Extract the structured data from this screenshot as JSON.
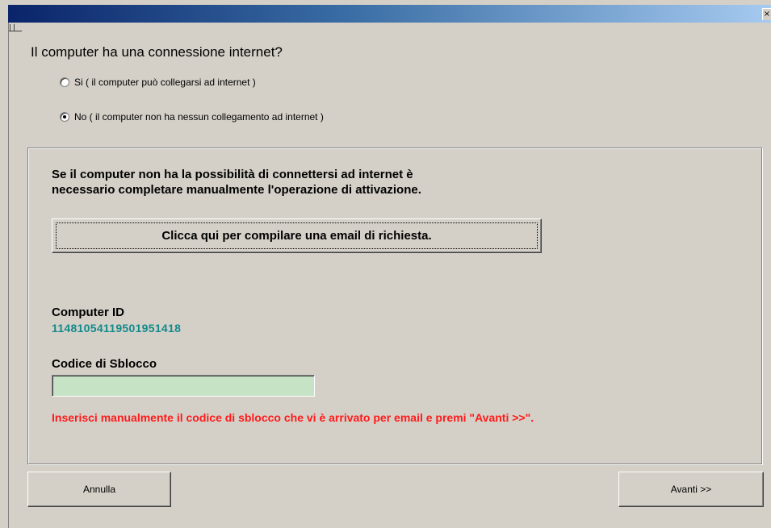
{
  "titlebar": {
    "close_label": "×"
  },
  "question": "Il computer ha una connessione internet?",
  "options": [
    {
      "label": "Si ( il computer può collegarsi ad internet )",
      "checked": false
    },
    {
      "label": "No ( il computer non ha nessun collegamento ad internet )",
      "checked": true
    }
  ],
  "panel": {
    "info_line1": "Se il computer non ha la possibilità di connettersi ad internet è",
    "info_line2": "necessario completare manualmente l'operazione di attivazione.",
    "email_button": "Clicca qui per compilare una email di richiesta.",
    "computer_id_label": "Computer ID",
    "computer_id_value": "11481054119501951418",
    "unlock_label": "Codice di Sblocco",
    "unlock_value": "",
    "hint": "Inserisci manualmente il codice di sblocco che vi è arrivato per email e premi \"Avanti >>\"."
  },
  "footer": {
    "cancel_label": "Annulla",
    "next_label": "Avanti >>"
  },
  "colors": {
    "computer_id": "#138a8a",
    "hint": "#ff1a1a",
    "input_background": "#c6e3c6"
  }
}
